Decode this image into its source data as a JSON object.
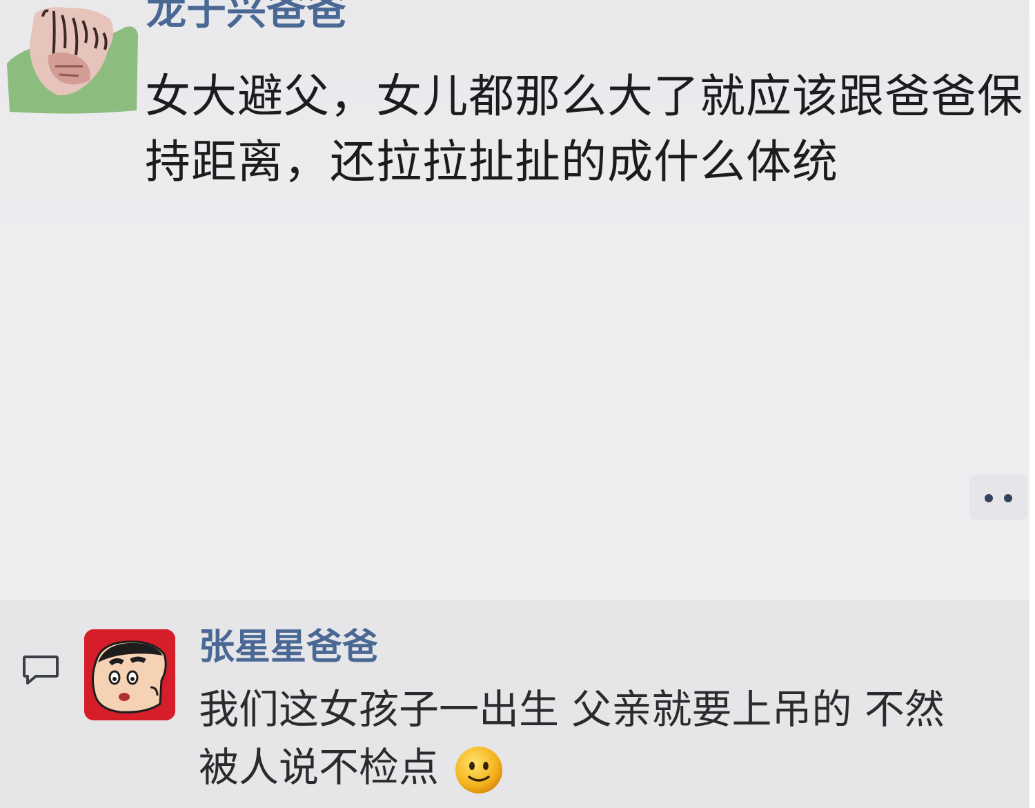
{
  "comments": [
    {
      "username": "龙于兴爸爸",
      "avatar": "green-ink-sketch-avatar",
      "lines": [
        "女大避父，女儿都那么大了就应该跟爸爸保",
        "持距离，还拉拉扯扯的成什么体统"
      ]
    },
    {
      "username": "张星星爸爸",
      "avatar": "crayon-shinchan-red-avatar",
      "lines": [
        "我们这女孩子一出生  父亲就要上吊的  不然",
        "被人说不检点"
      ],
      "emoji": "slightly-smiling-face"
    }
  ],
  "icons": {
    "more": "more-dots-icon",
    "reply": "comment-bubble-icon"
  },
  "colors": {
    "username": "#4a6894",
    "text": "#1c1c1e",
    "background": "#ebebee",
    "avatar2_bg": "#d61d2a"
  }
}
